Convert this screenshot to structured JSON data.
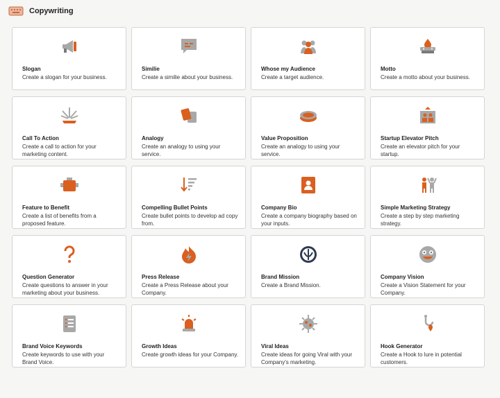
{
  "header": {
    "title": "Copywriting",
    "icon": "keyboard-icon"
  },
  "colors": {
    "accent": "#d9601f",
    "gray": "#a8a8a8",
    "border": "#d4d4d4"
  },
  "cards": [
    {
      "title": "Slogan",
      "desc": "Create a slogan for your business.",
      "icon": "megaphone-icon"
    },
    {
      "title": "Similie",
      "desc": "Create a similie about your business.",
      "icon": "chat-bubble-icon"
    },
    {
      "title": "Whose my Audience",
      "desc": "Create a target audience.",
      "icon": "audience-icon"
    },
    {
      "title": "Motto",
      "desc": "Create a motto about your business.",
      "icon": "flame-stage-icon"
    },
    {
      "title": "Call To Action",
      "desc": "Create a call to action for your marketing content.",
      "icon": "burst-icon"
    },
    {
      "title": "Analogy",
      "desc": "Create an analogy to using your service.",
      "icon": "cards-icon"
    },
    {
      "title": "Value Proposition",
      "desc": "Create an analogy to using your service.",
      "icon": "coin-icon"
    },
    {
      "title": "Startup Elevator Pitch",
      "desc": "Create an elevator pitch for your startup.",
      "icon": "elevator-icon"
    },
    {
      "title": "Feature to Benefit",
      "desc": "Create a list of benefits from a proposed feature.",
      "icon": "toolbox-icon"
    },
    {
      "title": "Compelling Bullet Points",
      "desc": "Create bullet points to develop ad copy from.",
      "icon": "sort-list-icon"
    },
    {
      "title": "Company Bio",
      "desc": "Create a company biography based on your inputs.",
      "icon": "contact-book-icon"
    },
    {
      "title": "Simple Marketing Strategy",
      "desc": "Create a step by step marketing strategy.",
      "icon": "people-cheer-icon"
    },
    {
      "title": "Question Generator",
      "desc": "Create questions to answer in your marketing about your business.",
      "icon": "question-icon"
    },
    {
      "title": "Press Release",
      "desc": "Create a Press Release about your Company.",
      "icon": "fire-bolt-icon"
    },
    {
      "title": "Brand Mission",
      "desc": "Create a Brand Mission.",
      "icon": "emblem-icon"
    },
    {
      "title": "Company Vision",
      "desc": "Create a Vision Statement for your Company.",
      "icon": "face-icon"
    },
    {
      "title": "Brand Voice Keywords",
      "desc": "Create keywords to use with your Brand Voice.",
      "icon": "checklist-icon"
    },
    {
      "title": "Growth Ideas",
      "desc": "Create growth ideas for your Company.",
      "icon": "siren-icon"
    },
    {
      "title": "Viral Ideas",
      "desc": "Create ideas for going Viral with your Company's marketing.",
      "icon": "virus-icon"
    },
    {
      "title": "Hook Generator",
      "desc": "Create a Hook to lure in potential customers.",
      "icon": "fishing-hook-icon"
    }
  ]
}
